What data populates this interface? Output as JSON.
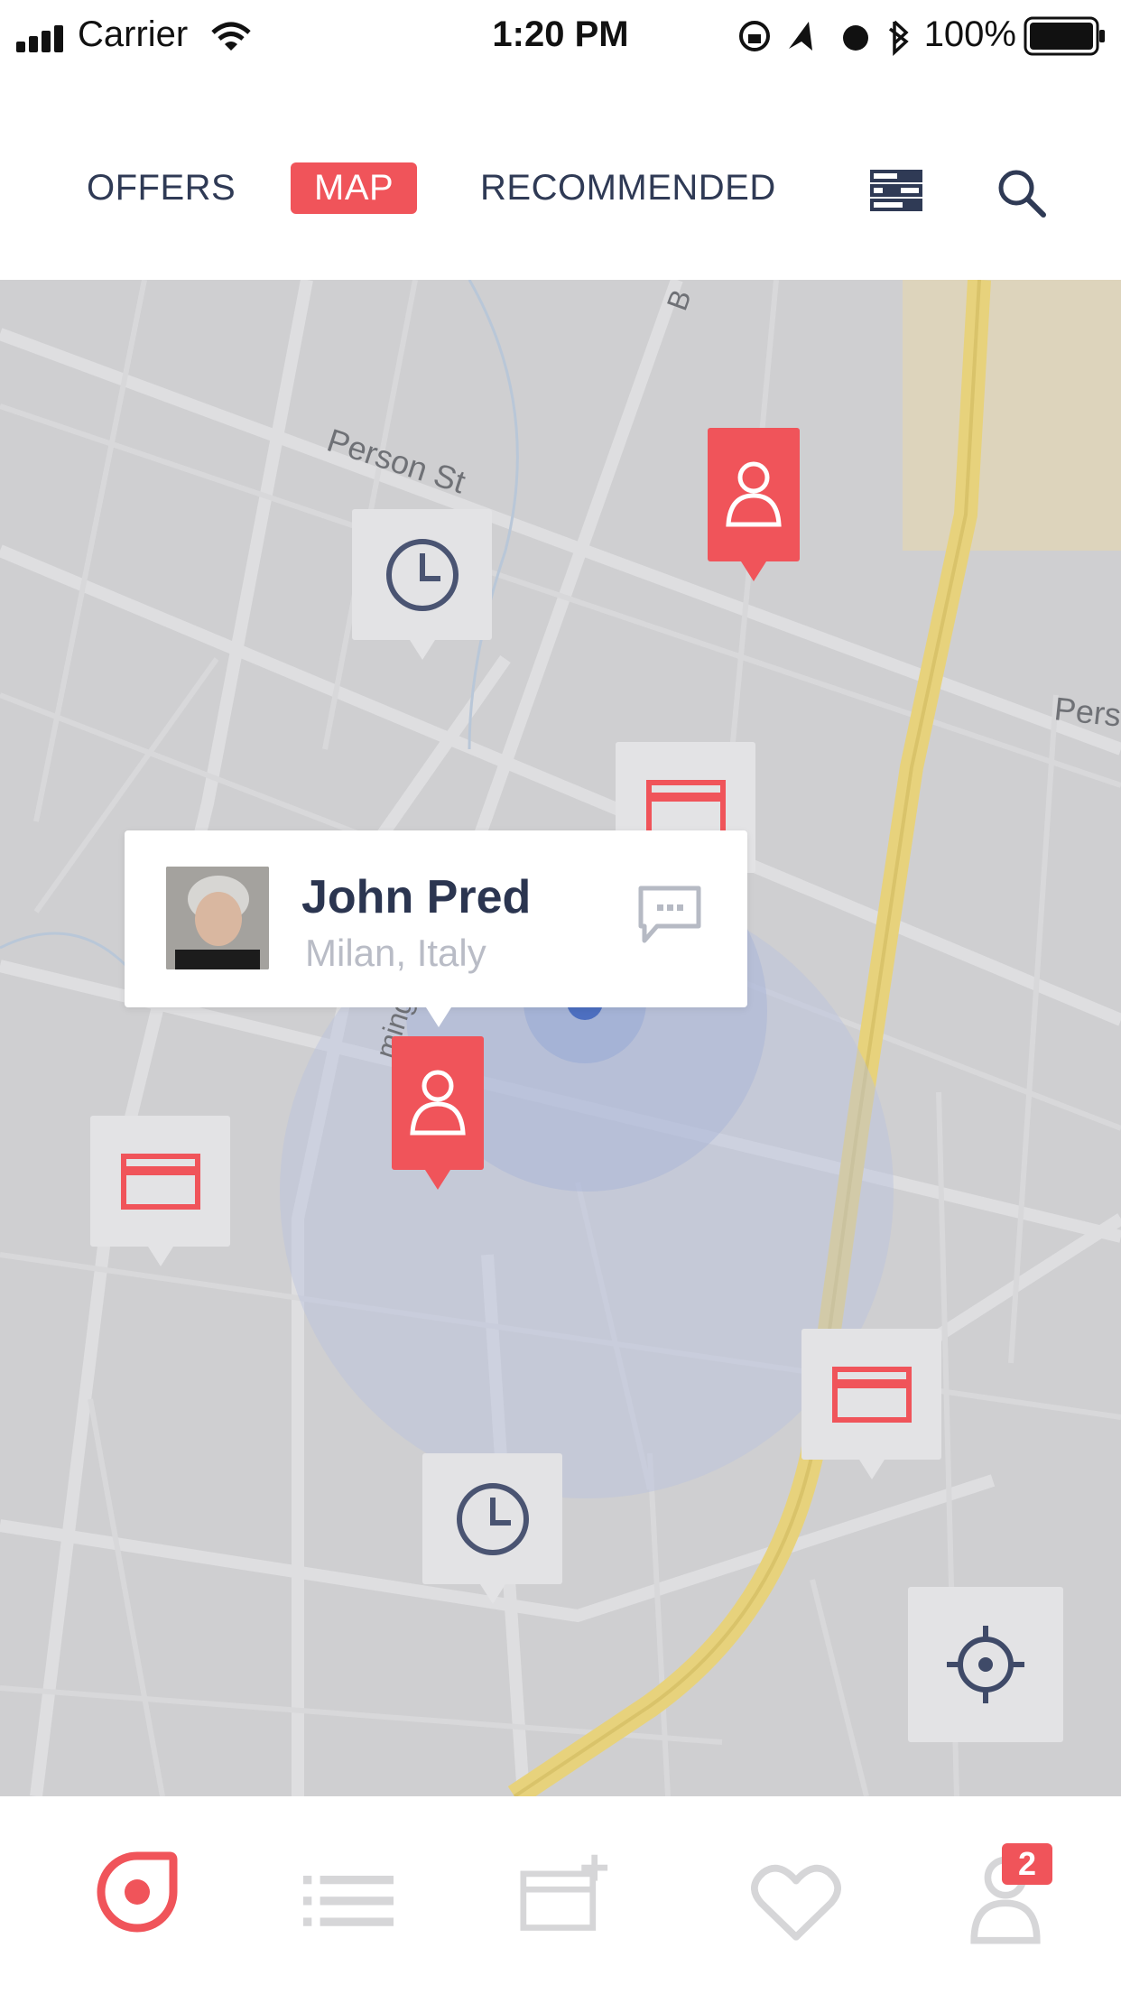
{
  "status_bar": {
    "carrier": "Carrier",
    "time": "1:20 PM",
    "battery": "100%"
  },
  "nav": {
    "tabs": [
      "OFFERS",
      "MAP",
      "RECOMMENDED"
    ],
    "active_tab": "MAP",
    "filter_icon": "sliders-icon",
    "search_icon": "search-icon"
  },
  "map": {
    "street_labels": [
      "Person St",
      "mington Rd",
      "Pers",
      "B"
    ],
    "pins": [
      {
        "type": "person",
        "icon": "person-icon",
        "highlighted": true
      },
      {
        "type": "clock",
        "icon": "clock-icon"
      },
      {
        "type": "card",
        "icon": "card-icon"
      },
      {
        "type": "person",
        "icon": "person-icon",
        "highlighted": true
      },
      {
        "type": "card",
        "icon": "card-icon"
      },
      {
        "type": "card",
        "icon": "card-icon"
      },
      {
        "type": "clock",
        "icon": "clock-icon"
      }
    ],
    "popup": {
      "name": "John Pred",
      "location": "Milan, Italy",
      "action_icon": "chat-bubble-icon"
    },
    "locate_icon": "crosshair-icon"
  },
  "tab_bar": {
    "items": [
      "explore-icon",
      "list-icon",
      "add-card-icon",
      "heart-icon",
      "profile-icon"
    ],
    "active": "explore-icon",
    "profile_badge": "2"
  },
  "colors": {
    "accent": "#f0545a",
    "text_dark": "#2b3550",
    "map_bg": "#cfcfd1",
    "pin_bg": "#e3e3e5",
    "road_major": "#e8d684"
  }
}
